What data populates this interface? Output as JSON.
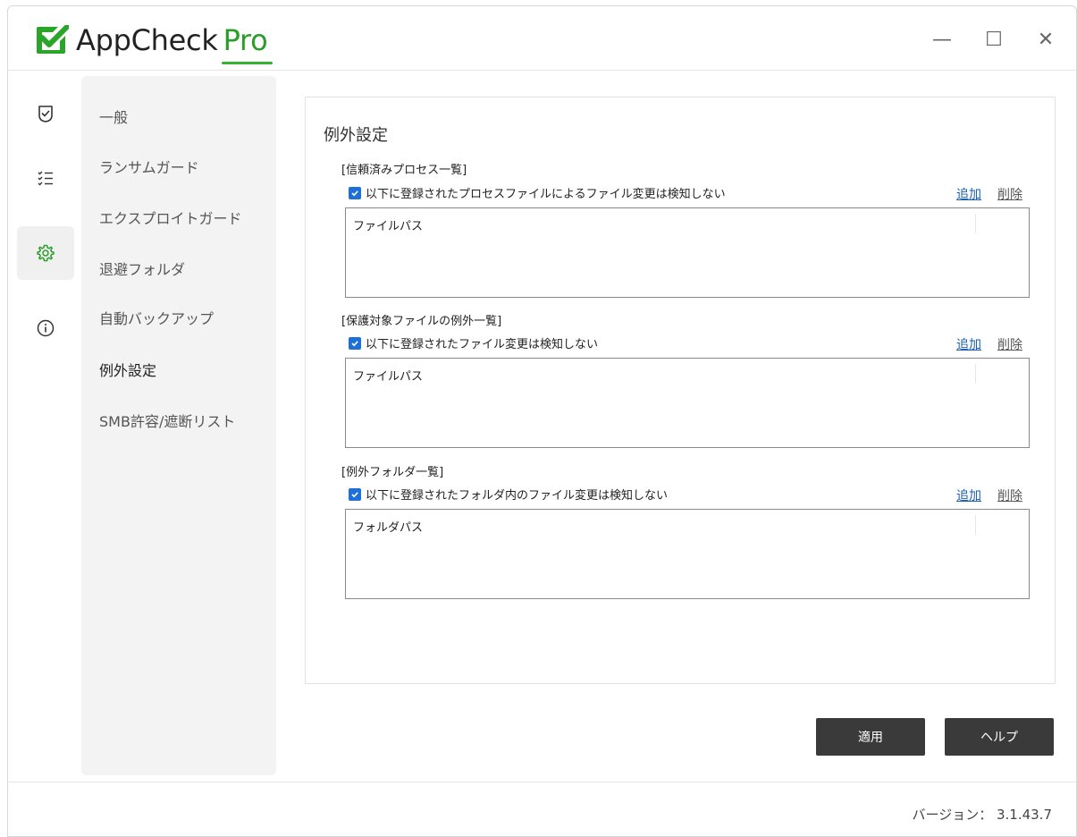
{
  "app": {
    "name": "AppCheck",
    "edition": "Pro",
    "brand_color": "#2a9d2a",
    "logo_icon": "shield-check-icon"
  },
  "window_controls": {
    "minimize": "—",
    "maximize": "☐",
    "close": "✕"
  },
  "rail": {
    "items": [
      {
        "icon": "shield-check-icon",
        "active": false
      },
      {
        "icon": "checklist-icon",
        "active": false
      },
      {
        "icon": "gear-icon",
        "active": true
      },
      {
        "icon": "info-icon",
        "active": false
      }
    ]
  },
  "submenu": {
    "items": [
      {
        "label": "一般"
      },
      {
        "label": "ランサムガード"
      },
      {
        "label": "エクスプロイトガード"
      },
      {
        "label": "退避フォルダ"
      },
      {
        "label": "自動バックアップ"
      },
      {
        "label": "例外設定"
      },
      {
        "label": "SMB許容/遮断リスト"
      }
    ],
    "active": "例外設定"
  },
  "panel": {
    "title": "例外設定",
    "sections": [
      {
        "heading": "[信頼済みプロセス一覧]",
        "checkbox_label": "以下に登録されたプロセスファイルによるファイル変更は検知しない",
        "checked": true,
        "add": "追加",
        "delete": "削除",
        "column": "ファイルパス"
      },
      {
        "heading": "[保護対象ファイルの例外一覧]",
        "checkbox_label": "以下に登録されたファイル変更は検知しない",
        "checked": true,
        "add": "追加",
        "delete": "削除",
        "column": "ファイルパス"
      },
      {
        "heading": "[例外フォルダ一覧]",
        "checkbox_label": "以下に登録されたフォルダ内のファイル変更は検知しない",
        "checked": true,
        "add": "追加",
        "delete": "削除",
        "column": "フォルダパス"
      }
    ]
  },
  "buttons": {
    "apply": "適用",
    "help": "ヘルプ"
  },
  "footer": {
    "version_label": "バージョン： 3.1.43.7"
  }
}
